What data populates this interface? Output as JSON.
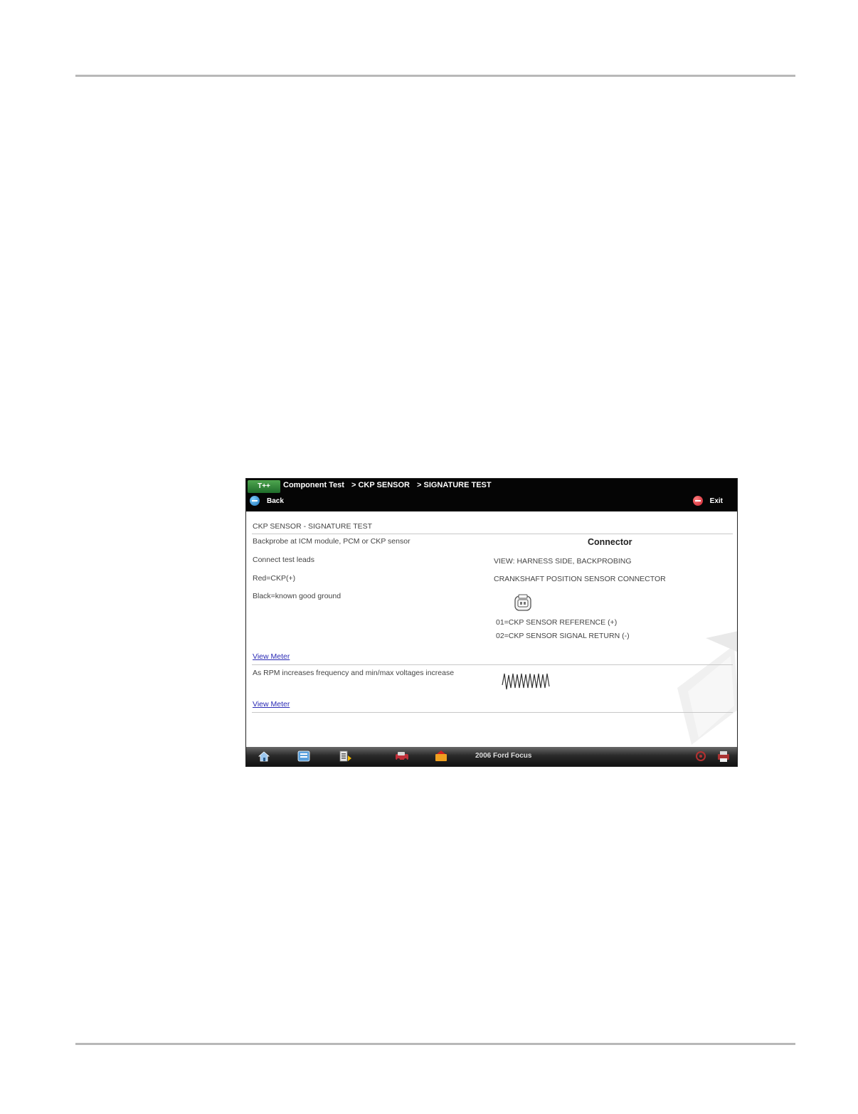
{
  "app": {
    "logo_text": "T++",
    "breadcrumb": [
      "Component Test",
      "> CKP SENSOR",
      "> SIGNATURE TEST"
    ],
    "back_label": "Back",
    "exit_label": "Exit"
  },
  "test": {
    "title": "CKP SENSOR - SIGNATURE TEST",
    "instructions": [
      "Backprobe at ICM module, PCM or CKP sensor",
      "Connect test leads",
      "Red=CKP(+)",
      "Black=known good ground"
    ],
    "connector_heading": "Connector",
    "connector_view": "VIEW: HARNESS SIDE, BACKPROBING",
    "connector_name": "CRANKSHAFT POSITION SENSOR CONNECTOR",
    "pins": [
      "01=CKP SENSOR REFERENCE (+)",
      "02=CKP SENSOR SIGNAL RETURN (-)"
    ],
    "view_meter_1": "View Meter",
    "signal_note": "As RPM increases frequency and min/max voltages increase",
    "view_meter_2": "View Meter"
  },
  "taskbar": {
    "icons": [
      "home-icon",
      "scanner-icon",
      "tools-icon",
      "vehicle-icon",
      "data-icon"
    ],
    "vehicle": "2006 Ford Focus",
    "right_icons": [
      "settings-icon",
      "print-icon"
    ]
  },
  "colors": {
    "topbar": "#050505",
    "link": "#2a2ab5",
    "back_icon": "#1a6fb5",
    "exit_icon": "#c81e2a"
  }
}
